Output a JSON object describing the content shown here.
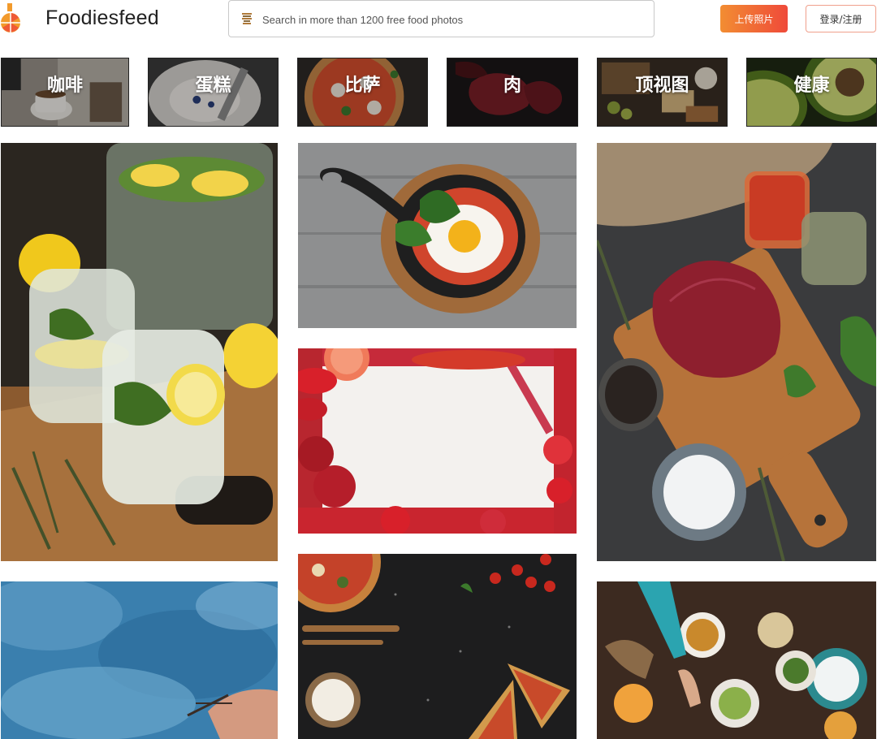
{
  "header": {
    "logo_text": "Foodiesfeed",
    "search_placeholder": "Search in more than 1200 free food photos",
    "upload_label": "上传照片",
    "login_label": "登录/注册"
  },
  "categories": [
    {
      "label": "咖啡"
    },
    {
      "label": "蛋糕"
    },
    {
      "label": "比萨"
    },
    {
      "label": "肉"
    },
    {
      "label": "顶视图"
    },
    {
      "label": "健康"
    }
  ],
  "photos": [
    {
      "icon": "lemon-drinks-photo"
    },
    {
      "icon": "egg-skillet-photo"
    },
    {
      "icon": "raw-steak-board-photo"
    },
    {
      "icon": "red-fruit-frame-photo"
    },
    {
      "icon": "pizza-slices-photo"
    },
    {
      "icon": "blue-background-photo"
    },
    {
      "icon": "table-feast-photo"
    }
  ],
  "colors": {
    "upload_gradient_start": "#f28d32",
    "upload_gradient_end": "#ef4a3a",
    "login_border": "#f0a08c"
  }
}
